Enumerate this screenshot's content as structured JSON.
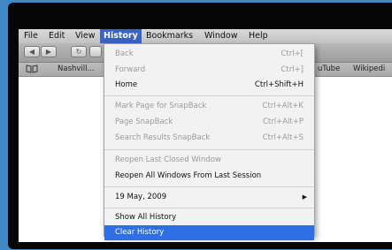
{
  "menubar": {
    "items": [
      "File",
      "Edit",
      "View",
      "History",
      "Bookmarks",
      "Window",
      "Help"
    ]
  },
  "toolbar": {
    "back_glyph": "◀",
    "forward_glyph": "▶",
    "reload_glyph": "↻"
  },
  "bookmarks_bar": {
    "icon": "book-icon",
    "items": [
      "Nashvill...",
      "uTube",
      "Wikipedi"
    ]
  },
  "history_menu": {
    "items": [
      {
        "label": "Back",
        "shortcut": "Ctrl+[",
        "enabled": false
      },
      {
        "label": "Forward",
        "shortcut": "Ctrl+]",
        "enabled": false
      },
      {
        "label": "Home",
        "shortcut": "Ctrl+Shift+H",
        "enabled": true
      },
      {
        "label": "Mark Page for SnapBack",
        "shortcut": "Ctrl+Alt+K",
        "enabled": false
      },
      {
        "label": "Page SnapBack",
        "shortcut": "Ctrl+Alt+P",
        "enabled": false
      },
      {
        "label": "Search Results SnapBack",
        "shortcut": "Ctrl+Alt+S",
        "enabled": false
      },
      {
        "label": "Reopen Last Closed Window",
        "shortcut": "",
        "enabled": false
      },
      {
        "label": "Reopen All Windows From Last Session",
        "shortcut": "",
        "enabled": true
      },
      {
        "label": "19 May, 2009",
        "shortcut": "",
        "submenu_arrow": "▶",
        "enabled": true
      },
      {
        "label": "Show All History",
        "shortcut": "",
        "enabled": true
      },
      {
        "label": "Clear History",
        "shortcut": "",
        "enabled": true,
        "selected": true
      }
    ]
  },
  "colors": {
    "desktop": "#3f88c4",
    "menu_highlight": "#2f6fe6",
    "active_menu_title": "#3a63c2"
  }
}
